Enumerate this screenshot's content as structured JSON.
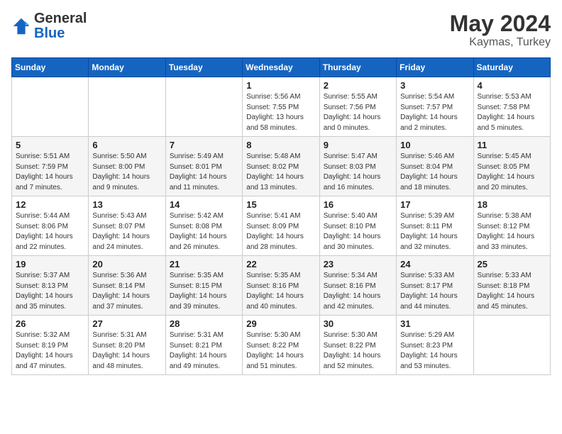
{
  "header": {
    "logo_general": "General",
    "logo_blue": "Blue",
    "title": "May 2024",
    "location": "Kaymas, Turkey"
  },
  "days_of_week": [
    "Sunday",
    "Monday",
    "Tuesday",
    "Wednesday",
    "Thursday",
    "Friday",
    "Saturday"
  ],
  "weeks": [
    [
      {
        "day": "",
        "sunrise": "",
        "sunset": "",
        "daylight": ""
      },
      {
        "day": "",
        "sunrise": "",
        "sunset": "",
        "daylight": ""
      },
      {
        "day": "",
        "sunrise": "",
        "sunset": "",
        "daylight": ""
      },
      {
        "day": "1",
        "sunrise": "Sunrise: 5:56 AM",
        "sunset": "Sunset: 7:55 PM",
        "daylight": "Daylight: 13 hours and 58 minutes."
      },
      {
        "day": "2",
        "sunrise": "Sunrise: 5:55 AM",
        "sunset": "Sunset: 7:56 PM",
        "daylight": "Daylight: 14 hours and 0 minutes."
      },
      {
        "day": "3",
        "sunrise": "Sunrise: 5:54 AM",
        "sunset": "Sunset: 7:57 PM",
        "daylight": "Daylight: 14 hours and 2 minutes."
      },
      {
        "day": "4",
        "sunrise": "Sunrise: 5:53 AM",
        "sunset": "Sunset: 7:58 PM",
        "daylight": "Daylight: 14 hours and 5 minutes."
      }
    ],
    [
      {
        "day": "5",
        "sunrise": "Sunrise: 5:51 AM",
        "sunset": "Sunset: 7:59 PM",
        "daylight": "Daylight: 14 hours and 7 minutes."
      },
      {
        "day": "6",
        "sunrise": "Sunrise: 5:50 AM",
        "sunset": "Sunset: 8:00 PM",
        "daylight": "Daylight: 14 hours and 9 minutes."
      },
      {
        "day": "7",
        "sunrise": "Sunrise: 5:49 AM",
        "sunset": "Sunset: 8:01 PM",
        "daylight": "Daylight: 14 hours and 11 minutes."
      },
      {
        "day": "8",
        "sunrise": "Sunrise: 5:48 AM",
        "sunset": "Sunset: 8:02 PM",
        "daylight": "Daylight: 14 hours and 13 minutes."
      },
      {
        "day": "9",
        "sunrise": "Sunrise: 5:47 AM",
        "sunset": "Sunset: 8:03 PM",
        "daylight": "Daylight: 14 hours and 16 minutes."
      },
      {
        "day": "10",
        "sunrise": "Sunrise: 5:46 AM",
        "sunset": "Sunset: 8:04 PM",
        "daylight": "Daylight: 14 hours and 18 minutes."
      },
      {
        "day": "11",
        "sunrise": "Sunrise: 5:45 AM",
        "sunset": "Sunset: 8:05 PM",
        "daylight": "Daylight: 14 hours and 20 minutes."
      }
    ],
    [
      {
        "day": "12",
        "sunrise": "Sunrise: 5:44 AM",
        "sunset": "Sunset: 8:06 PM",
        "daylight": "Daylight: 14 hours and 22 minutes."
      },
      {
        "day": "13",
        "sunrise": "Sunrise: 5:43 AM",
        "sunset": "Sunset: 8:07 PM",
        "daylight": "Daylight: 14 hours and 24 minutes."
      },
      {
        "day": "14",
        "sunrise": "Sunrise: 5:42 AM",
        "sunset": "Sunset: 8:08 PM",
        "daylight": "Daylight: 14 hours and 26 minutes."
      },
      {
        "day": "15",
        "sunrise": "Sunrise: 5:41 AM",
        "sunset": "Sunset: 8:09 PM",
        "daylight": "Daylight: 14 hours and 28 minutes."
      },
      {
        "day": "16",
        "sunrise": "Sunrise: 5:40 AM",
        "sunset": "Sunset: 8:10 PM",
        "daylight": "Daylight: 14 hours and 30 minutes."
      },
      {
        "day": "17",
        "sunrise": "Sunrise: 5:39 AM",
        "sunset": "Sunset: 8:11 PM",
        "daylight": "Daylight: 14 hours and 32 minutes."
      },
      {
        "day": "18",
        "sunrise": "Sunrise: 5:38 AM",
        "sunset": "Sunset: 8:12 PM",
        "daylight": "Daylight: 14 hours and 33 minutes."
      }
    ],
    [
      {
        "day": "19",
        "sunrise": "Sunrise: 5:37 AM",
        "sunset": "Sunset: 8:13 PM",
        "daylight": "Daylight: 14 hours and 35 minutes."
      },
      {
        "day": "20",
        "sunrise": "Sunrise: 5:36 AM",
        "sunset": "Sunset: 8:14 PM",
        "daylight": "Daylight: 14 hours and 37 minutes."
      },
      {
        "day": "21",
        "sunrise": "Sunrise: 5:35 AM",
        "sunset": "Sunset: 8:15 PM",
        "daylight": "Daylight: 14 hours and 39 minutes."
      },
      {
        "day": "22",
        "sunrise": "Sunrise: 5:35 AM",
        "sunset": "Sunset: 8:16 PM",
        "daylight": "Daylight: 14 hours and 40 minutes."
      },
      {
        "day": "23",
        "sunrise": "Sunrise: 5:34 AM",
        "sunset": "Sunset: 8:16 PM",
        "daylight": "Daylight: 14 hours and 42 minutes."
      },
      {
        "day": "24",
        "sunrise": "Sunrise: 5:33 AM",
        "sunset": "Sunset: 8:17 PM",
        "daylight": "Daylight: 14 hours and 44 minutes."
      },
      {
        "day": "25",
        "sunrise": "Sunrise: 5:33 AM",
        "sunset": "Sunset: 8:18 PM",
        "daylight": "Daylight: 14 hours and 45 minutes."
      }
    ],
    [
      {
        "day": "26",
        "sunrise": "Sunrise: 5:32 AM",
        "sunset": "Sunset: 8:19 PM",
        "daylight": "Daylight: 14 hours and 47 minutes."
      },
      {
        "day": "27",
        "sunrise": "Sunrise: 5:31 AM",
        "sunset": "Sunset: 8:20 PM",
        "daylight": "Daylight: 14 hours and 48 minutes."
      },
      {
        "day": "28",
        "sunrise": "Sunrise: 5:31 AM",
        "sunset": "Sunset: 8:21 PM",
        "daylight": "Daylight: 14 hours and 49 minutes."
      },
      {
        "day": "29",
        "sunrise": "Sunrise: 5:30 AM",
        "sunset": "Sunset: 8:22 PM",
        "daylight": "Daylight: 14 hours and 51 minutes."
      },
      {
        "day": "30",
        "sunrise": "Sunrise: 5:30 AM",
        "sunset": "Sunset: 8:22 PM",
        "daylight": "Daylight: 14 hours and 52 minutes."
      },
      {
        "day": "31",
        "sunrise": "Sunrise: 5:29 AM",
        "sunset": "Sunset: 8:23 PM",
        "daylight": "Daylight: 14 hours and 53 minutes."
      },
      {
        "day": "",
        "sunrise": "",
        "sunset": "",
        "daylight": ""
      }
    ]
  ]
}
